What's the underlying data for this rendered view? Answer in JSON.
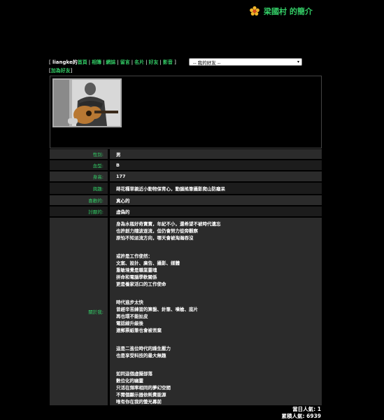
{
  "header": {
    "title": "梁國村 的簡介",
    "icon": "flower-icon"
  },
  "nav": {
    "user": "liangke的",
    "links": [
      "首頁",
      "相簿",
      "網誌",
      "留言",
      "名片",
      "好友",
      "影音"
    ],
    "friend_select": "-- 我的好友 --"
  },
  "add_friend": "加為好友",
  "profile": {
    "gender": {
      "label": "性別:",
      "value": "男"
    },
    "blood": {
      "label": "血型:",
      "value": "B"
    },
    "height": {
      "label": "身高:",
      "value": "177"
    },
    "hobbies": {
      "label": "興趣:",
      "value": "蒔花種草親近小動物保育心，動腦搖筆攝影爬山防癡呆"
    },
    "likes": {
      "label": "喜歡的:",
      "value": "真心的"
    },
    "dislikes": {
      "label": "討厭的:",
      "value": "虛偽的"
    },
    "about": {
      "label": "關於我:",
      "lines": [
        "身為水瓶好奇寶寶，年紀不小，還希望不被時代遺忘",
        "也許創力隨波逐流，但仍會努力從旁觀察",
        "原怕不知派流方向，哪天會被淘瀚吞沒",
        "",
        "",
        "或許是工作使然：",
        "文案、設計、廣告、攝影、媒體",
        "重敏境覺是職業靈魂",
        "拼命和電腦學軟關係",
        "更是養家活口的工作使命",
        "",
        "",
        "時代進步太快",
        "曾經辛苦練習的算盤、針筆、噴槍、底片",
        "再也環不能扯皮",
        "電話線升級後",
        "連郵票紙筆也會被丟棄",
        "",
        "",
        "這是二進位時代的躁生壓力",
        "也是享受科技的最大無趣",
        "",
        "",
        "如同這個虛擬部落",
        "數位化的幽靈",
        "只活在頻率相同的夢幻空間",
        "不需個顯示器依耗費能源",
        "唯有你在我的螢光幕前"
      ]
    }
  },
  "counts": {
    "today": "當日人氣: 1",
    "total": "累積人氣: 6939"
  },
  "colors": {
    "accent": "#33cc66",
    "row_bg": "#2b2b2b",
    "background": "#000000"
  }
}
